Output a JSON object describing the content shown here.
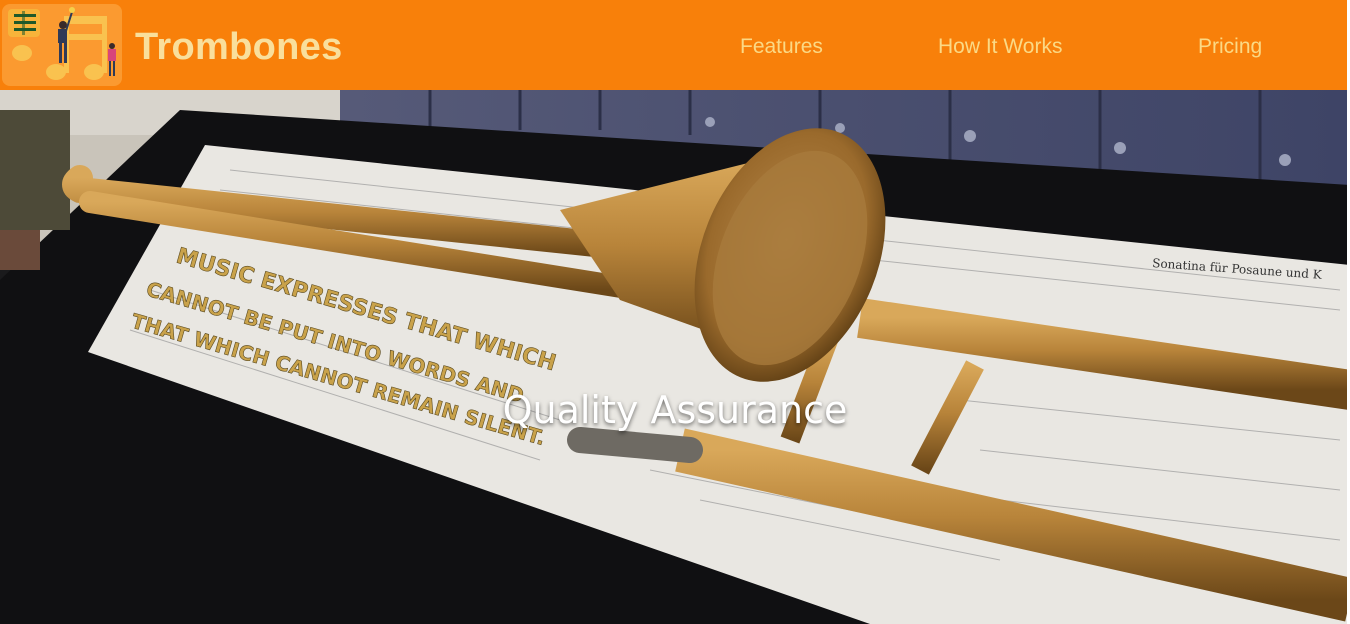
{
  "header": {
    "brand": "Trombones",
    "menu_icon": "hamburger-menu-icon",
    "logo_icon": "music-notes-people-logo",
    "nav": [
      {
        "label": "Features"
      },
      {
        "label": "How It Works"
      },
      {
        "label": "Pricing"
      }
    ]
  },
  "hero": {
    "title": "Quality Assurance",
    "image": "brass-trombone-on-sheet-music-photo",
    "quote_lines": [
      "MUSIC EXPRESSES THAT WHICH",
      "CANNOT BE PUT INTO WORDS AND",
      "THAT WHICH CANNOT REMAIN SILENT."
    ],
    "sheet_title": "Sonatina für Posaune und K"
  },
  "colors": {
    "accent": "#f8800a",
    "nav_text": "#fbd985",
    "brand_text": "#f9df9c"
  }
}
